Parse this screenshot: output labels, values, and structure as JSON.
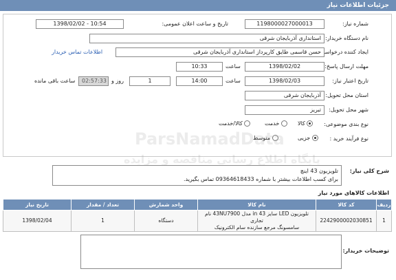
{
  "header": {
    "title": "جزئیات اطلاعات نیاز"
  },
  "form": {
    "need_number_label": "شماره نیاز:",
    "need_number": "1198000027000013",
    "announce_label": "تاریخ و ساعت اعلان عمومی:",
    "announce_value": "1398/02/02 - 10:54",
    "buyer_org_label": "نام دستگاه خریدار:",
    "buyer_org": "استانداری آذربایجان شرقی",
    "creator_label": "ایجاد کننده درخواست:",
    "creator": "حسن قاسمی طایق کارپرداز استانداری آذربایجان شرقی",
    "contact_link": "اطلاعات تماس خریدار",
    "deadline_label": "مهلت ارسال پاسخ:",
    "deadline_date": "1398/02/02",
    "deadline_time_label": "ساعت",
    "deadline_time": "10:33",
    "validity_label": "تاریخ اعتبار نیاز:",
    "validity_date": "1398/02/03",
    "validity_time_label": "ساعت",
    "validity_time": "14:00",
    "days_value": "1",
    "days_label": "روز و",
    "remaining_time": "02:57:33",
    "remaining_label": "ساعت باقی مانده",
    "province_label": "استان محل تحویل:",
    "province": "آذربایجان شرقی",
    "city_label": "شهر محل تحویل:",
    "city": "تبریز",
    "category_label": "نوع بندی موضوعی:",
    "category_options": [
      "کالا",
      "خدمت",
      "کالا/خدمت"
    ],
    "category_selected": "کالا",
    "process_label": "نوع فرآیند خرید :",
    "process_options": [
      "جزیی",
      "متوسط"
    ],
    "process_selected": "جزیی"
  },
  "description": {
    "label": "شرح کلی نیاز:",
    "line1": "تلویزیون 43 اینچ",
    "line2": "برای کسب اطلاعات بیشتر با شماره 09364618433 تماس بگیرید."
  },
  "items": {
    "section_title": "اطلاعات کالاهای مورد نیاز",
    "columns": [
      "ردیف",
      "کد کالا",
      "نام کالا",
      "واحد شمارش",
      "تعداد / مقدار",
      "تاریخ نیاز"
    ],
    "rows": [
      {
        "row": "1",
        "code": "2242900002030851",
        "name_line1": "تلویزیون LED سایز in 43 مدل 43NU7900 نام تجاری",
        "name_line2": "سامسونگ مرجع سازنده سام الکترونیک",
        "unit": "دستگاه",
        "qty": "1",
        "date": "1398/02/04"
      }
    ]
  },
  "notes": {
    "label": "توضیحات خریدار:",
    "value": ""
  },
  "watermark": {
    "line1": "ParsNamadData",
    "line2": "پایگاه اطلاع رسانی مناقصه و مزایده"
  }
}
